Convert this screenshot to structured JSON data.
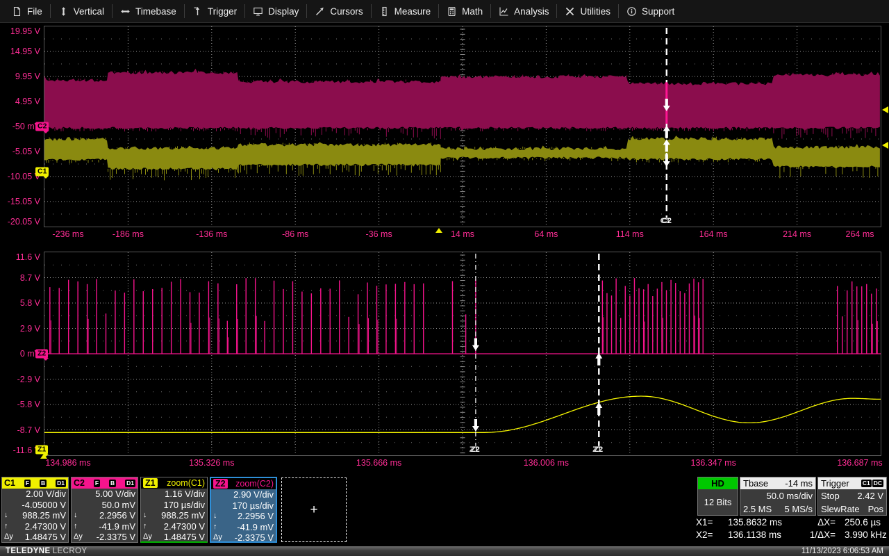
{
  "menu": {
    "items": [
      {
        "icon": "file-icon",
        "label": "File"
      },
      {
        "icon": "vertical-icon",
        "label": "Vertical"
      },
      {
        "icon": "timebase-icon",
        "label": "Timebase"
      },
      {
        "icon": "trigger-icon",
        "label": "Trigger"
      },
      {
        "icon": "display-icon",
        "label": "Display"
      },
      {
        "icon": "cursors-icon",
        "label": "Cursors"
      },
      {
        "icon": "measure-icon",
        "label": "Measure"
      },
      {
        "icon": "math-icon",
        "label": "Math"
      },
      {
        "icon": "analysis-icon",
        "label": "Analysis"
      },
      {
        "icon": "utilities-icon",
        "label": "Utilities"
      },
      {
        "icon": "support-icon",
        "label": "Support"
      }
    ]
  },
  "colors": {
    "axis_text": "#ff2e96",
    "c1_trace": "#f0f000",
    "c1_fill": "#8a8a10",
    "c2_trace": "#f5148c",
    "c2_fill": "#8b0d4d",
    "hd_green": "#00c800",
    "z2_body_bg": "#3a6487",
    "selected_border": "#2e8fd8",
    "grid_line": "#8f8f8f"
  },
  "top_grid": {
    "y_labels": [
      "19.95 V",
      "14.95 V",
      "9.95 V",
      "4.95 V",
      "-50 mV",
      "-5.05 V",
      "-10.05 V",
      "-15.05 V",
      "-20.05 V"
    ],
    "x_labels": [
      "-236 ms",
      "-186 ms",
      "-136 ms",
      "-86 ms",
      "-36 ms",
      "14 ms",
      "64 ms",
      "114 ms",
      "164 ms",
      "214 ms",
      "264 ms"
    ]
  },
  "bottom_grid": {
    "y_labels": [
      "11.6 V",
      "8.7 V",
      "5.8 V",
      "2.9 V",
      "0 mV",
      "-2.9 V",
      "-5.8 V",
      "-8.7 V",
      "-11.6 V"
    ],
    "x_labels": [
      "134.986 ms",
      "135.326 ms",
      "135.666 ms",
      "136.006 ms",
      "136.347 ms",
      "136.687 ms"
    ]
  },
  "chart_data": [
    {
      "id": "main",
      "type": "area",
      "title": "Main acquisition grid",
      "x_unit": "ms",
      "y_unit": "V",
      "x_range": [
        -236,
        264
      ],
      "y_range": [
        -20.05,
        19.95
      ],
      "x_div": "50.0 ms/div",
      "grid": "dotted",
      "series": [
        {
          "name": "C2",
          "kind": "noise_band",
          "color": "#8b0d4d",
          "base_v": -0.35,
          "segments": [
            {
              "t0": -236,
              "t1": -198,
              "top": 9.2
            },
            {
              "t0": -198,
              "t1": -120,
              "top": 10.7
            },
            {
              "t0": -120,
              "t1": 1,
              "top": 8.9,
              "hairy": true
            },
            {
              "t0": 1,
              "t1": 113,
              "top": 9.9
            },
            {
              "t0": 113,
              "t1": 200,
              "top": 8.5
            },
            {
              "t0": 200,
              "t1": 264,
              "top": 10.3,
              "hairy": true
            }
          ]
        },
        {
          "name": "C1",
          "kind": "noise_band",
          "color": "#8a8a10",
          "segments": [
            {
              "t0": -236,
              "t1": -198,
              "top": -2.6,
              "bot": -6.7
            },
            {
              "t0": -198,
              "t1": -120,
              "top": -4.4,
              "bot": -8.5,
              "hairy": true
            },
            {
              "t0": -120,
              "t1": 1,
              "top": -3.7,
              "bot": -7.7,
              "hairy": true
            },
            {
              "t0": 1,
              "t1": 113,
              "top": -4.5,
              "bot": -6.3
            },
            {
              "t0": 113,
              "t1": 200,
              "top": -2.5,
              "bot": -6.6
            },
            {
              "t0": 200,
              "t1": 264,
              "top": -4.2,
              "bot": -8.1,
              "hairy": true
            }
          ]
        }
      ],
      "trigger_time": 0,
      "cursors": [
        {
          "t": 136.0,
          "style": "dashed",
          "labels": [
            "C1",
            "C2"
          ],
          "arrows": [
            {
              "v": 3.0,
              "dir": "down"
            },
            {
              "v": 0.15,
              "dir": "up"
            },
            {
              "v": -2.6,
              "dir": "up"
            },
            {
              "v": -8.1,
              "dir": "down"
            }
          ],
          "highlight": {
            "v0": 8.8,
            "v1": 0.5,
            "color": "#ff1493"
          }
        }
      ],
      "right_markers": [
        {
          "v": 3.3
        },
        {
          "v": -3.8
        }
      ],
      "tabs": [
        {
          "label": "C2",
          "v": -0.05,
          "color": "#f5148c"
        },
        {
          "label": "C1",
          "v": -9.05,
          "color": "#f0f000"
        }
      ]
    },
    {
      "id": "zoom",
      "type": "line",
      "title": "Zoom grid",
      "x_unit": "ms",
      "y_unit": "V",
      "x_range": [
        134.986,
        136.687
      ],
      "y_range": [
        -11.6,
        11.6
      ],
      "x_div": "170 µs/div",
      "grid": "dotted",
      "series": [
        {
          "name": "Z2",
          "kind": "pulses",
          "color": "#f5148c",
          "base_v": 0,
          "clusters": [
            {
              "t0": 134.997,
              "t1": 135.762,
              "dt": 0.019,
              "hmin": 6.8,
              "hmax": 8.7
            },
            {
              "t0": 136.121,
              "t1": 136.327,
              "dt": 0.0093,
              "hmin": 6.5,
              "hmax": 8.7
            },
            {
              "t0": 136.599,
              "t1": 136.69,
              "dt": 0.0099,
              "hmin": 6.5,
              "hmax": 8.7
            }
          ],
          "singles": [
            [
              135.816,
              8.3
            ],
            [
              135.843,
              4.5
            ],
            [
              135.8632,
              8.5
            ]
          ]
        },
        {
          "name": "Z1",
          "kind": "smooth",
          "color": "#f5f500",
          "points": [
            [
              134.986,
              -9.0
            ],
            [
              135.88,
              -9.0
            ],
            [
              136.2,
              -4.85
            ],
            [
              136.42,
              -7.9
            ],
            [
              136.63,
              -5.1
            ],
            [
              136.687,
              -5.2
            ]
          ]
        }
      ],
      "cursors": [
        {
          "t": 135.8632,
          "style": "dashdot",
          "labels": [
            "Z1",
            "Z2"
          ],
          "arrows": [
            {
              "v": 0.35,
              "dir": "down"
            },
            {
              "v": -8.9,
              "dir": "down"
            }
          ]
        },
        {
          "t": 136.1138,
          "style": "dashed",
          "labels": [
            "Z1",
            "Z2"
          ],
          "arrows": [
            {
              "v": 0.1,
              "dir": "up"
            },
            {
              "v": -5.56,
              "dir": "up"
            }
          ]
        }
      ],
      "tabs": [
        {
          "label": "Z2",
          "v": 0,
          "color": "#f5148c"
        },
        {
          "label": "Z1",
          "v": -11.3,
          "color": "#f0f000"
        }
      ]
    }
  ],
  "channel_boxes": [
    {
      "id": "C1",
      "header_bg": "#f0f000",
      "badges": [
        "F",
        "B",
        "D1"
      ],
      "rows": [
        {
          "pre": "",
          "val": "2.00 V/div"
        },
        {
          "pre": "",
          "val": "-4.05000 V"
        },
        {
          "pre": "↓",
          "val": "988.25 mV"
        },
        {
          "pre": "↑",
          "val": "2.47300 V"
        },
        {
          "pre": "Δy",
          "val": "1.48475 V"
        }
      ]
    },
    {
      "id": "C2",
      "header_bg": "#f5148c",
      "badges": [
        "F",
        "B",
        "D1"
      ],
      "rows": [
        {
          "pre": "",
          "val": "5.00 V/div"
        },
        {
          "pre": "",
          "val": "50.0 mV"
        },
        {
          "pre": "↓",
          "val": "2.2956 V"
        },
        {
          "pre": "↑",
          "val": "-41.9 mV"
        },
        {
          "pre": "Δy",
          "val": "-2.3375 V"
        }
      ]
    },
    {
      "id": "Z1",
      "header_bg": "#f0f000",
      "title": "zoom(C1)",
      "underline": "#00b400",
      "rows": [
        {
          "pre": "",
          "val": "1.16 V/div"
        },
        {
          "pre": "",
          "val": "170 µs/div"
        },
        {
          "pre": "↓",
          "val": "988.25 mV"
        },
        {
          "pre": "↑",
          "val": "2.47300 V"
        },
        {
          "pre": "Δy",
          "val": "1.48475 V"
        }
      ]
    },
    {
      "id": "Z2",
      "header_bg": "#f5148c",
      "title": "zoom(C2)",
      "selected": true,
      "rows": [
        {
          "pre": "",
          "val": "2.90 V/div"
        },
        {
          "pre": "",
          "val": "170 µs/div"
        },
        {
          "pre": "↓",
          "val": "2.2956 V"
        },
        {
          "pre": "↑",
          "val": "-41.9 mV"
        },
        {
          "pre": "Δy",
          "val": "-2.3375 V"
        }
      ]
    }
  ],
  "add_box": {
    "plus": "+"
  },
  "panels": {
    "hd": {
      "title": "HD",
      "body": "12 Bits"
    },
    "tbase": {
      "title": "Tbase",
      "value": "-14 ms",
      "line1": "50.0 ms/div",
      "line2_left": "2.5 MS",
      "line2_right": "5 MS/s"
    },
    "trigger": {
      "title": "Trigger",
      "badges": [
        "C1",
        "DC"
      ],
      "rows": [
        {
          "left": "Stop",
          "right": "2.42 V"
        },
        {
          "left": "SlewRate",
          "right": "Pos"
        }
      ]
    }
  },
  "cursor_readout": {
    "x1_label": "X1=",
    "x1": "135.8632 ms",
    "dx_label": "ΔX=",
    "dx": "250.6 µs",
    "x2_label": "X2=",
    "x2": "136.1138 ms",
    "invdx_label": "1/ΔX=",
    "invdx": "3.990 kHz"
  },
  "statusbar": {
    "brand_bold": "TELEDYNE",
    "brand_light": "LECROY",
    "datetime": "11/13/2023 6:06:53 AM"
  }
}
